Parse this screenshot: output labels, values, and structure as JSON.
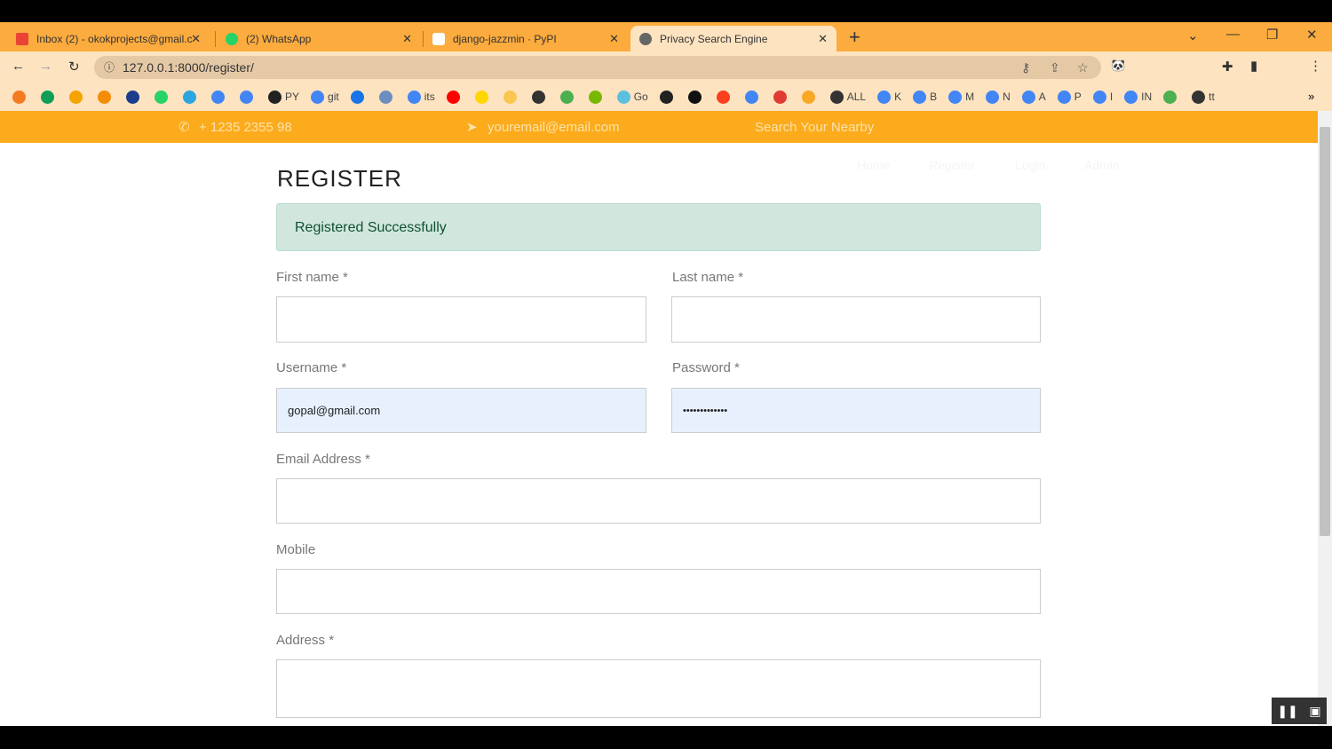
{
  "browser": {
    "tabs": [
      {
        "title": "Inbox (2) - okokprojects@gmail.c",
        "icon": "gmail-icon",
        "color": "#ea4335"
      },
      {
        "title": "(2) WhatsApp",
        "icon": "whatsapp-icon",
        "color": "#25d366"
      },
      {
        "title": "django-jazzmin · PyPI",
        "icon": "pypi-icon",
        "color": "#ffffff"
      },
      {
        "title": "Privacy Search Engine",
        "icon": "globe-icon",
        "color": "#666666"
      }
    ],
    "url": "127.0.0.1:8000/register/",
    "bookmarks": [
      {
        "label": "",
        "color": "#f47b20"
      },
      {
        "label": "",
        "color": "#0f9d58"
      },
      {
        "label": "",
        "color": "#f4a300"
      },
      {
        "label": "",
        "color": "#f48c06"
      },
      {
        "label": "",
        "color": "#1a3e8c"
      },
      {
        "label": "",
        "color": "#25d366"
      },
      {
        "label": "",
        "color": "#2ca5e0"
      },
      {
        "label": "",
        "color": "#4285f4"
      },
      {
        "label": "",
        "color": "#4285f4"
      },
      {
        "label": "PY",
        "color": "#222222"
      },
      {
        "label": "git",
        "color": "#4285f4"
      },
      {
        "label": "",
        "color": "#1a73e8"
      },
      {
        "label": "",
        "color": "#6c8ebf"
      },
      {
        "label": "its",
        "color": "#4285f4"
      },
      {
        "label": "",
        "color": "#ff0000"
      },
      {
        "label": "",
        "color": "#ffd600"
      },
      {
        "label": "",
        "color": "#f9c74f"
      },
      {
        "label": "",
        "color": "#333333"
      },
      {
        "label": "",
        "color": "#4caf50"
      },
      {
        "label": "",
        "color": "#76b900"
      },
      {
        "label": "Go",
        "color": "#5bc0de"
      },
      {
        "label": "",
        "color": "#222222"
      },
      {
        "label": "",
        "color": "#111111"
      },
      {
        "label": "",
        "color": "#fc3f1d"
      },
      {
        "label": "",
        "color": "#4285f4"
      },
      {
        "label": "",
        "color": "#e03c31"
      },
      {
        "label": "",
        "color": "#f9a825"
      },
      {
        "label": "ALL",
        "color": "#333333"
      },
      {
        "label": "K",
        "color": "#4285f4"
      },
      {
        "label": "B",
        "color": "#4285f4"
      },
      {
        "label": "M",
        "color": "#4285f4"
      },
      {
        "label": "N",
        "color": "#4285f4"
      },
      {
        "label": "A",
        "color": "#4285f4"
      },
      {
        "label": "P",
        "color": "#4285f4"
      },
      {
        "label": "I",
        "color": "#4285f4"
      },
      {
        "label": "IN",
        "color": "#4285f4"
      },
      {
        "label": "",
        "color": "#4caf50"
      },
      {
        "label": "tt",
        "color": "#333333"
      }
    ],
    "more": "»"
  },
  "topbar": {
    "phone": "+ 1235 2355 98",
    "email": "youremail@email.com",
    "search": "Search Your Nearby"
  },
  "nav": [
    "Home",
    "Register",
    "Login",
    "Admin"
  ],
  "page": {
    "title": "REGISTER",
    "alert": "Registered Successfully",
    "fields": {
      "first_name": {
        "label": "First name *",
        "value": ""
      },
      "last_name": {
        "label": "Last name *",
        "value": ""
      },
      "username": {
        "label": "Username *",
        "value": "gopal@gmail.com"
      },
      "password": {
        "label": "Password *",
        "value": "•••••••••••••"
      },
      "email": {
        "label": "Email Address *",
        "value": ""
      },
      "mobile": {
        "label": "Mobile",
        "value": ""
      },
      "address": {
        "label": "Address *",
        "value": ""
      }
    }
  }
}
